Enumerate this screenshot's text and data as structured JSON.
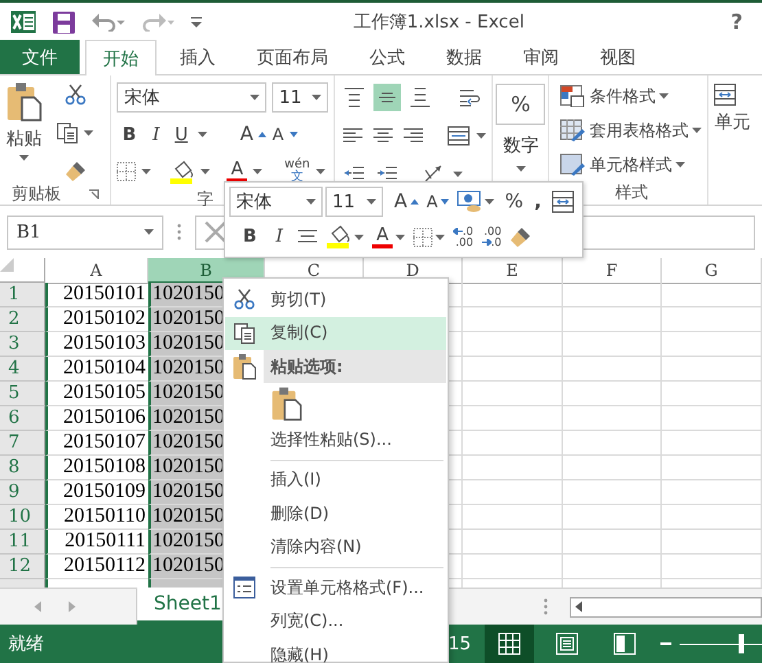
{
  "window": {
    "title": "工作簿1.xlsx - Excel",
    "help": "?"
  },
  "ribbon_tabs": [
    {
      "label": "文件",
      "kind": "file",
      "selected": false
    },
    {
      "label": "开始",
      "kind": "tab",
      "selected": true
    },
    {
      "label": "插入",
      "kind": "tab",
      "selected": false
    },
    {
      "label": "页面布局",
      "kind": "tab",
      "selected": false
    },
    {
      "label": "公式",
      "kind": "tab",
      "selected": false
    },
    {
      "label": "数据",
      "kind": "tab",
      "selected": false
    },
    {
      "label": "审阅",
      "kind": "tab",
      "selected": false
    },
    {
      "label": "视图",
      "kind": "tab",
      "selected": false
    }
  ],
  "ribbon": {
    "clipboard": {
      "paste": "粘贴",
      "group": "剪贴板"
    },
    "font": {
      "name": "宋体",
      "size": "11",
      "bold": "B",
      "italic": "I",
      "underline": "U",
      "grow": "A",
      "shrink": "A",
      "font_color": "A",
      "phonetic": [
        "wén",
        "文"
      ],
      "group": "字"
    },
    "alignment": [
      {
        "kind": "top",
        "selected": false
      },
      {
        "kind": "middle",
        "selected": true
      },
      {
        "kind": "bottom",
        "selected": false
      },
      {
        "kind": "wrap",
        "selected": false
      },
      {
        "kind": "left",
        "selected": false
      },
      {
        "kind": "center",
        "selected": false
      },
      {
        "kind": "right",
        "selected": false
      },
      {
        "kind": "merge",
        "selected": false
      },
      {
        "kind": "outdent",
        "selected": false
      },
      {
        "kind": "indent",
        "selected": false
      },
      {
        "kind": "orientation",
        "selected": false
      }
    ],
    "number": {
      "symbol": "%",
      "label": "数字"
    },
    "styles": {
      "items": [
        "条件格式",
        "套用表格格式",
        "单元格样式"
      ],
      "group": "样式"
    },
    "cells": {
      "label": "单元"
    }
  },
  "formula_bar": {
    "name_box": "B1"
  },
  "mini_toolbar": {
    "font": "宋体",
    "size": "11",
    "grow": "A",
    "shrink": "A",
    "percent": "%",
    "comma": ",",
    "bold": "B",
    "italic": "I",
    "font_color": "A",
    "increase_decimal": [
      ".0",
      ".00"
    ],
    "decrease_decimal": [
      ".00",
      ".0"
    ]
  },
  "sheet": {
    "columns": [
      {
        "label": "A",
        "selected": false
      },
      {
        "label": "B",
        "selected": true
      },
      {
        "label": "C",
        "selected": false
      },
      {
        "label": "D",
        "selected": false
      },
      {
        "label": "E",
        "selected": false
      },
      {
        "label": "F",
        "selected": false
      },
      {
        "label": "G",
        "selected": false
      }
    ],
    "rows": [
      {
        "number": "1",
        "a": "20150101",
        "b": "1020150"
      },
      {
        "number": "2",
        "a": "20150102",
        "b": "1020150"
      },
      {
        "number": "3",
        "a": "20150103",
        "b": "1020150"
      },
      {
        "number": "4",
        "a": "20150104",
        "b": "1020150"
      },
      {
        "number": "5",
        "a": "20150105",
        "b": "1020150"
      },
      {
        "number": "6",
        "a": "20150106",
        "b": "1020150"
      },
      {
        "number": "7",
        "a": "20150107",
        "b": "1020150"
      },
      {
        "number": "8",
        "a": "20150108",
        "b": "1020150"
      },
      {
        "number": "9",
        "a": "20150109",
        "b": "1020150"
      },
      {
        "number": "10",
        "a": "20150110",
        "b": "1020150"
      },
      {
        "number": "11",
        "a": "20150111",
        "b": "1020150"
      },
      {
        "number": "12",
        "a": "20150112",
        "b": "1020150"
      }
    ]
  },
  "context_menu": [
    {
      "kind": "item",
      "label": "剪切(T)",
      "selected": false
    },
    {
      "kind": "item",
      "label": "复制(C)",
      "selected": true
    },
    {
      "kind": "header",
      "label": "粘贴选项:"
    },
    {
      "kind": "paste_option"
    },
    {
      "kind": "item",
      "label": "选择性粘贴(S)...",
      "selected": false
    },
    {
      "kind": "separator"
    },
    {
      "kind": "item",
      "label": "插入(I)",
      "selected": false
    },
    {
      "kind": "item",
      "label": "删除(D)",
      "selected": false
    },
    {
      "kind": "item",
      "label": "清除内容(N)",
      "selected": false
    },
    {
      "kind": "separator"
    },
    {
      "kind": "item",
      "label": "设置单元格格式(F)...",
      "selected": false
    },
    {
      "kind": "item",
      "label": "列宽(C)...",
      "selected": false
    },
    {
      "kind": "item",
      "label": "隐藏(H)",
      "selected": false
    }
  ],
  "sheet_tabs": [
    {
      "label": "Sheet1",
      "selected": true
    }
  ],
  "status_bar": {
    "status": "就绪",
    "count": "15",
    "zoom": {
      "level": 0.75
    }
  }
}
